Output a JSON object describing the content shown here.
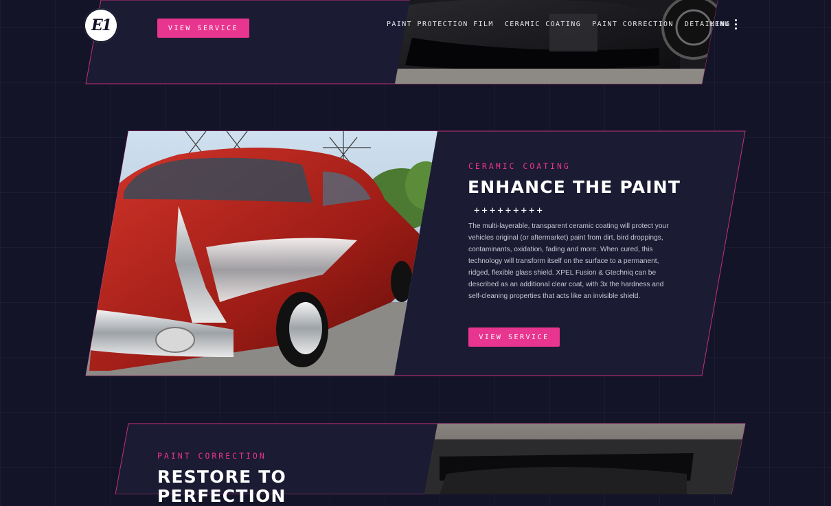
{
  "header": {
    "logo_text": "E1",
    "view_service_label": "VIEW SERVICE",
    "nav": [
      "PAINT PROTECTION FILM",
      "CERAMIC COATING",
      "PAINT CORRECTION",
      "DETAILING"
    ],
    "menu_label": "MENU"
  },
  "ceramic": {
    "eyebrow": "CERAMIC COATING",
    "title": "ENHANCE THE PAINT",
    "divider": "+++++++++",
    "body": "The multi-layerable, transparent ceramic coating will protect your vehicles original (or aftermarket) paint from dirt, bird droppings, contaminants, oxidation, fading and more. When cured, this technology will transform itself on the surface to a permanent, ridged, flexible glass shield. XPEL Fusion & Gtechniq can be described as an additional clear coat, with 3x the hardness and self-cleaning properties that acts like an invisible shield.",
    "button_label": "VIEW SERVICE"
  },
  "correction": {
    "eyebrow": "PAINT CORRECTION",
    "title_line1": "RESTORE TO",
    "title_line2": "PERFECTION"
  },
  "colors": {
    "accent": "#e8358f",
    "background": "#141428",
    "panel": "#1b1b33"
  }
}
